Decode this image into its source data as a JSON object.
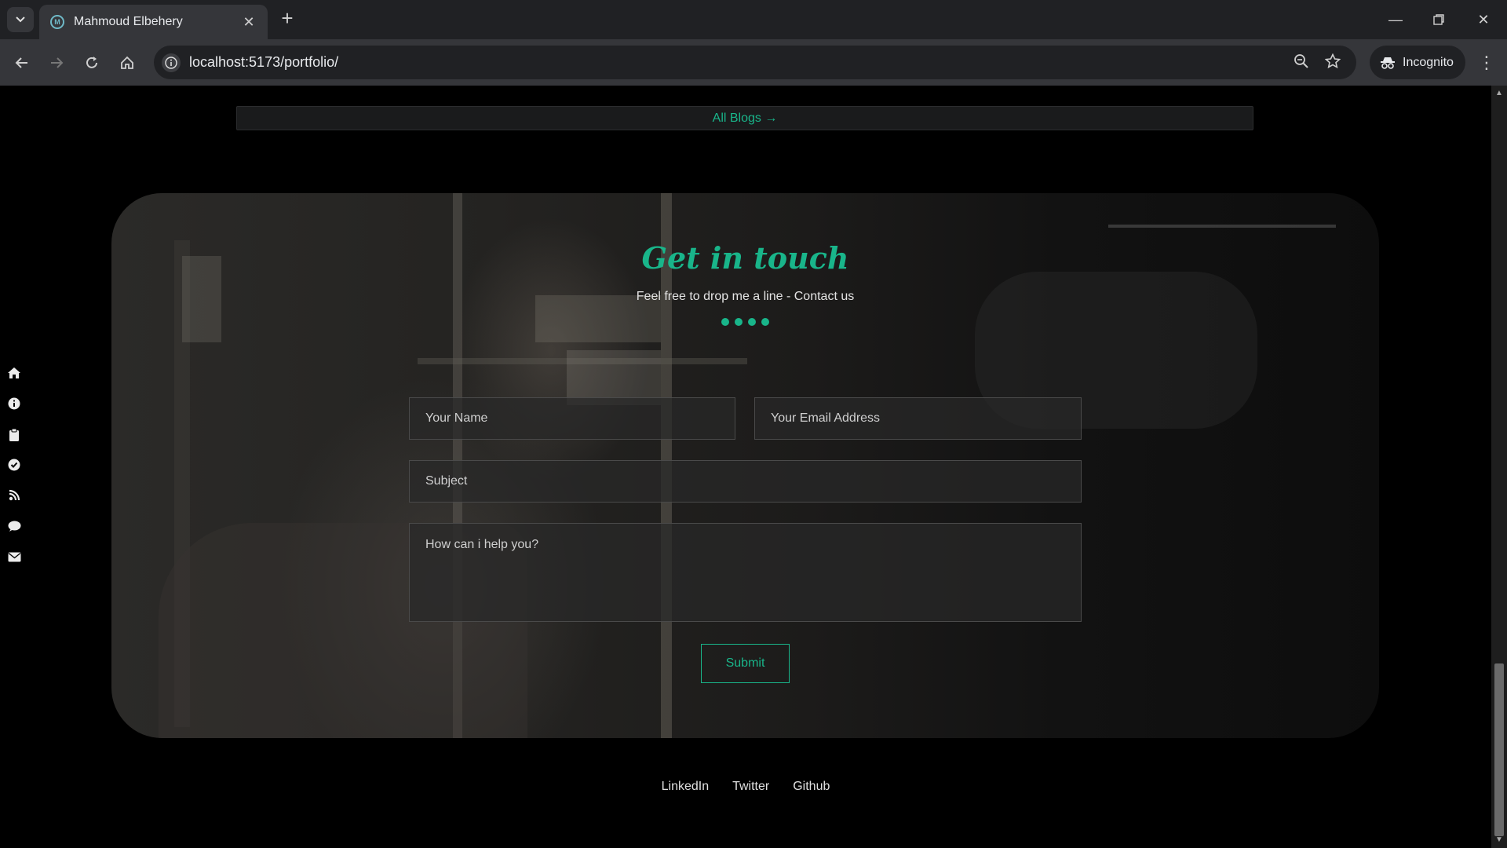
{
  "browser": {
    "tab_title": "Mahmoud Elbehery",
    "favicon_text": "M",
    "url": "localhost:5173/portfolio/",
    "incognito_label": "Incognito"
  },
  "page": {
    "all_blogs_label": "All Blogs →",
    "side_nav_icons": [
      "home-icon",
      "info-icon",
      "clipboard-icon",
      "check-circle-icon",
      "blog-icon",
      "comment-icon",
      "envelope-icon"
    ],
    "contact": {
      "heading": "Get in touch",
      "subheading": "Feel free to drop me a line - Contact us",
      "name_placeholder": "Your Name",
      "email_placeholder": "Your Email Address",
      "subject_placeholder": "Subject",
      "message_placeholder": "How can i help you?",
      "submit_label": "Submit"
    },
    "footer": {
      "links": [
        "LinkedIn",
        "Twitter",
        "Github"
      ]
    },
    "accent_color": "#19b58a"
  }
}
